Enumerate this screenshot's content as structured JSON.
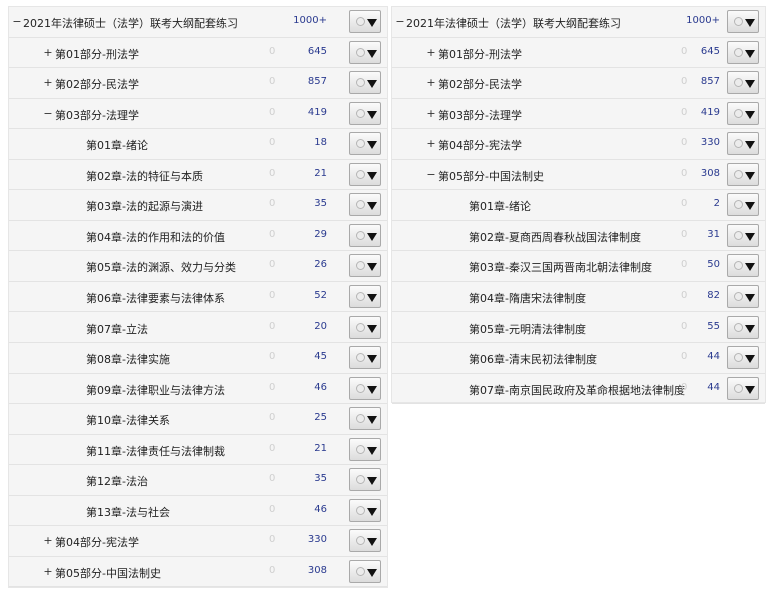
{
  "left": {
    "rows": [
      {
        "toggle": "−",
        "title": "2021年法律硕士（法学）联考大纲配套练习",
        "zero": "",
        "count": "1000+",
        "level": 0
      },
      {
        "toggle": "+",
        "title": "第01部分-刑法学",
        "zero": "0",
        "count": "645",
        "level": 1
      },
      {
        "toggle": "+",
        "title": "第02部分-民法学",
        "zero": "0",
        "count": "857",
        "level": 1
      },
      {
        "toggle": "−",
        "title": "第03部分-法理学",
        "zero": "0",
        "count": "419",
        "level": 1
      },
      {
        "toggle": "",
        "title": "第01章-绪论",
        "zero": "0",
        "count": "18",
        "level": 2
      },
      {
        "toggle": "",
        "title": "第02章-法的特征与本质",
        "zero": "0",
        "count": "21",
        "level": 2
      },
      {
        "toggle": "",
        "title": "第03章-法的起源与演进",
        "zero": "0",
        "count": "35",
        "level": 2
      },
      {
        "toggle": "",
        "title": "第04章-法的作用和法的价值",
        "zero": "0",
        "count": "29",
        "level": 2
      },
      {
        "toggle": "",
        "title": "第05章-法的渊源、效力与分类",
        "zero": "0",
        "count": "26",
        "level": 2
      },
      {
        "toggle": "",
        "title": "第06章-法律要素与法律体系",
        "zero": "0",
        "count": "52",
        "level": 2
      },
      {
        "toggle": "",
        "title": "第07章-立法",
        "zero": "0",
        "count": "20",
        "level": 2
      },
      {
        "toggle": "",
        "title": "第08章-法律实施",
        "zero": "0",
        "count": "45",
        "level": 2
      },
      {
        "toggle": "",
        "title": "第09章-法律职业与法律方法",
        "zero": "0",
        "count": "46",
        "level": 2
      },
      {
        "toggle": "",
        "title": "第10章-法律关系",
        "zero": "0",
        "count": "25",
        "level": 2
      },
      {
        "toggle": "",
        "title": "第11章-法律责任与法律制裁",
        "zero": "0",
        "count": "21",
        "level": 2
      },
      {
        "toggle": "",
        "title": "第12章-法治",
        "zero": "0",
        "count": "35",
        "level": 2
      },
      {
        "toggle": "",
        "title": "第13章-法与社会",
        "zero": "0",
        "count": "46",
        "level": 2
      },
      {
        "toggle": "+",
        "title": "第04部分-宪法学",
        "zero": "0",
        "count": "330",
        "level": 1
      },
      {
        "toggle": "+",
        "title": "第05部分-中国法制史",
        "zero": "0",
        "count": "308",
        "level": 1
      }
    ]
  },
  "right": {
    "rows": [
      {
        "toggle": "−",
        "title": "2021年法律硕士（法学）联考大纲配套练习",
        "zero": "",
        "count": "1000+",
        "level": 0
      },
      {
        "toggle": "+",
        "title": "第01部分-刑法学",
        "zero": "0",
        "count": "645",
        "level": 1
      },
      {
        "toggle": "+",
        "title": "第02部分-民法学",
        "zero": "0",
        "count": "857",
        "level": 1
      },
      {
        "toggle": "+",
        "title": "第03部分-法理学",
        "zero": "0",
        "count": "419",
        "level": 1
      },
      {
        "toggle": "+",
        "title": "第04部分-宪法学",
        "zero": "0",
        "count": "330",
        "level": 1
      },
      {
        "toggle": "−",
        "title": "第05部分-中国法制史",
        "zero": "0",
        "count": "308",
        "level": 1
      },
      {
        "toggle": "",
        "title": "第01章-绪论",
        "zero": "0",
        "count": "2",
        "level": 2
      },
      {
        "toggle": "",
        "title": "第02章-夏商西周春秋战国法律制度",
        "zero": "0",
        "count": "31",
        "level": 2
      },
      {
        "toggle": "",
        "title": "第03章-秦汉三国两晋南北朝法律制度",
        "zero": "0",
        "count": "50",
        "level": 2
      },
      {
        "toggle": "",
        "title": "第04章-隋唐宋法律制度",
        "zero": "0",
        "count": "82",
        "level": 2
      },
      {
        "toggle": "",
        "title": "第05章-元明清法律制度",
        "zero": "0",
        "count": "55",
        "level": 2
      },
      {
        "toggle": "",
        "title": "第06章-清末民初法律制度",
        "zero": "0",
        "count": "44",
        "level": 2
      },
      {
        "toggle": "",
        "title": "第07章-南京国民政府及革命根据地法律制度",
        "zero": "0",
        "count": "44",
        "level": 2
      }
    ]
  },
  "icons": {
    "status": "circle-icon",
    "dropdown": "triangle-down-icon"
  },
  "colors": {
    "count": "#2a3a8f",
    "zero": "#cfcfcf",
    "panel_bg": "#f5f5f5"
  }
}
